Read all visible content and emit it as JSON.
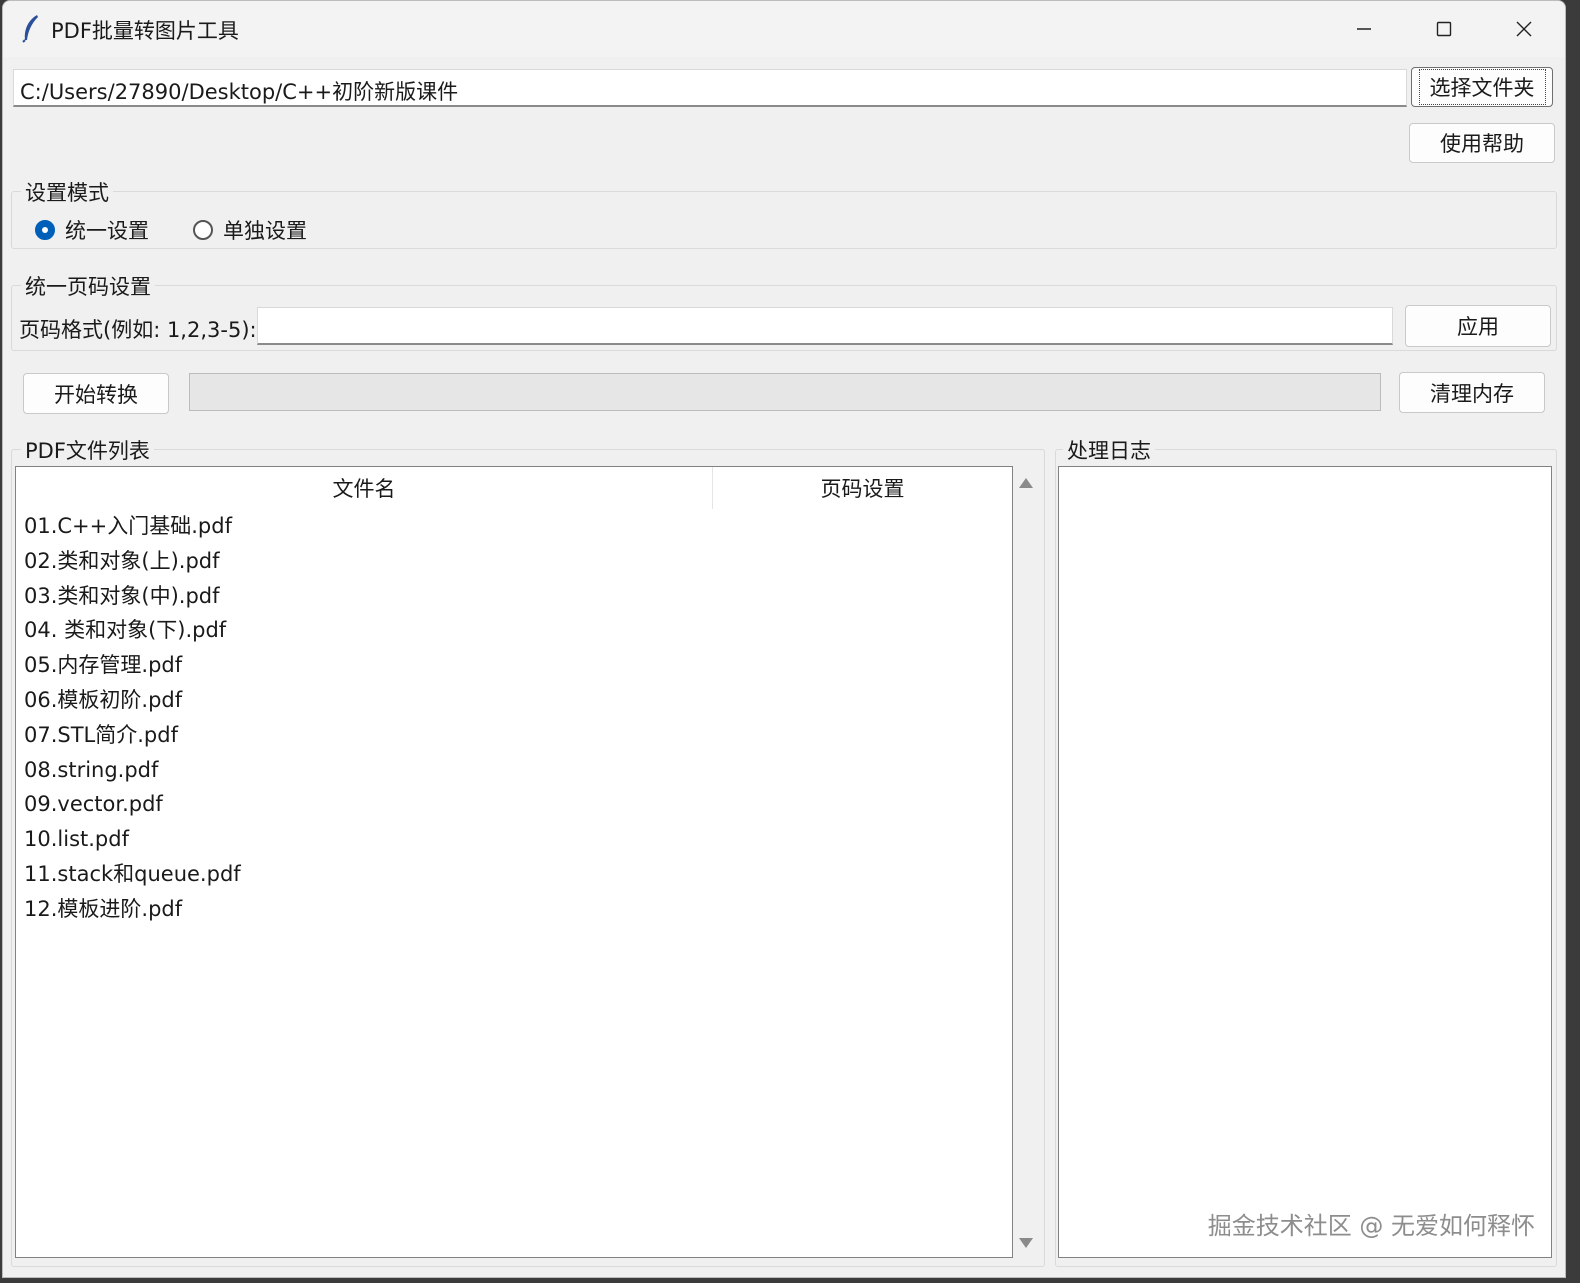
{
  "window": {
    "title": "PDF批量转图片工具"
  },
  "folder": {
    "path": "C:/Users/27890/Desktop/C++初阶新版课件",
    "choose_label": "选择文件夹",
    "help_label": "使用帮助"
  },
  "mode": {
    "legend": "设置模式",
    "options": [
      "统一设置",
      "单独设置"
    ],
    "selected": "统一设置"
  },
  "uniform": {
    "legend": "统一页码设置",
    "label": "页码格式(例如: 1,2,3-5):",
    "value": "",
    "apply_label": "应用"
  },
  "actions": {
    "start_label": "开始转换",
    "progress": 0,
    "clear_label": "清理内存"
  },
  "file_list": {
    "legend": "PDF文件列表",
    "columns": [
      "文件名",
      "页码设置"
    ],
    "rows": [
      "01.C++入门基础.pdf",
      "02.类和对象(上).pdf",
      "03.类和对象(中).pdf",
      "04. 类和对象(下).pdf",
      "05.内存管理.pdf",
      "06.模板初阶.pdf",
      "07.STL简介.pdf",
      "08.string.pdf",
      "09.vector.pdf",
      "10.list.pdf",
      "11.stack和queue.pdf",
      "12.模板进阶.pdf"
    ]
  },
  "log": {
    "legend": "处理日志"
  },
  "watermark": "掘金技术社区 @ 无爱如何释怀",
  "colors": {
    "accent": "#005fb8",
    "window_bg": "#f0f0f0"
  }
}
